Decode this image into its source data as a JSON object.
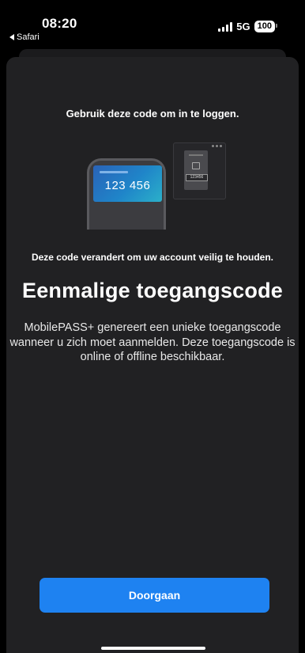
{
  "status_bar": {
    "time": "08:20",
    "back_app": "Safari",
    "network": "5G",
    "battery": "100"
  },
  "content": {
    "intro": "Gebruik deze code om in te loggen.",
    "illustration": {
      "phone_code": "123 456",
      "monitor_code": "123456"
    },
    "subtitle": "Deze code verandert om uw account veilig te houden.",
    "title": "Eenmalige toegangscode",
    "description": "MobilePASS+ genereert een unieke toegangscode wanneer u zich moet aanmelden. Deze toegangscode is online of offline beschikbaar."
  },
  "actions": {
    "continue_label": "Doorgaan"
  },
  "colors": {
    "background": "#000000",
    "sheet": "#212123",
    "accent": "#1e82f1"
  }
}
